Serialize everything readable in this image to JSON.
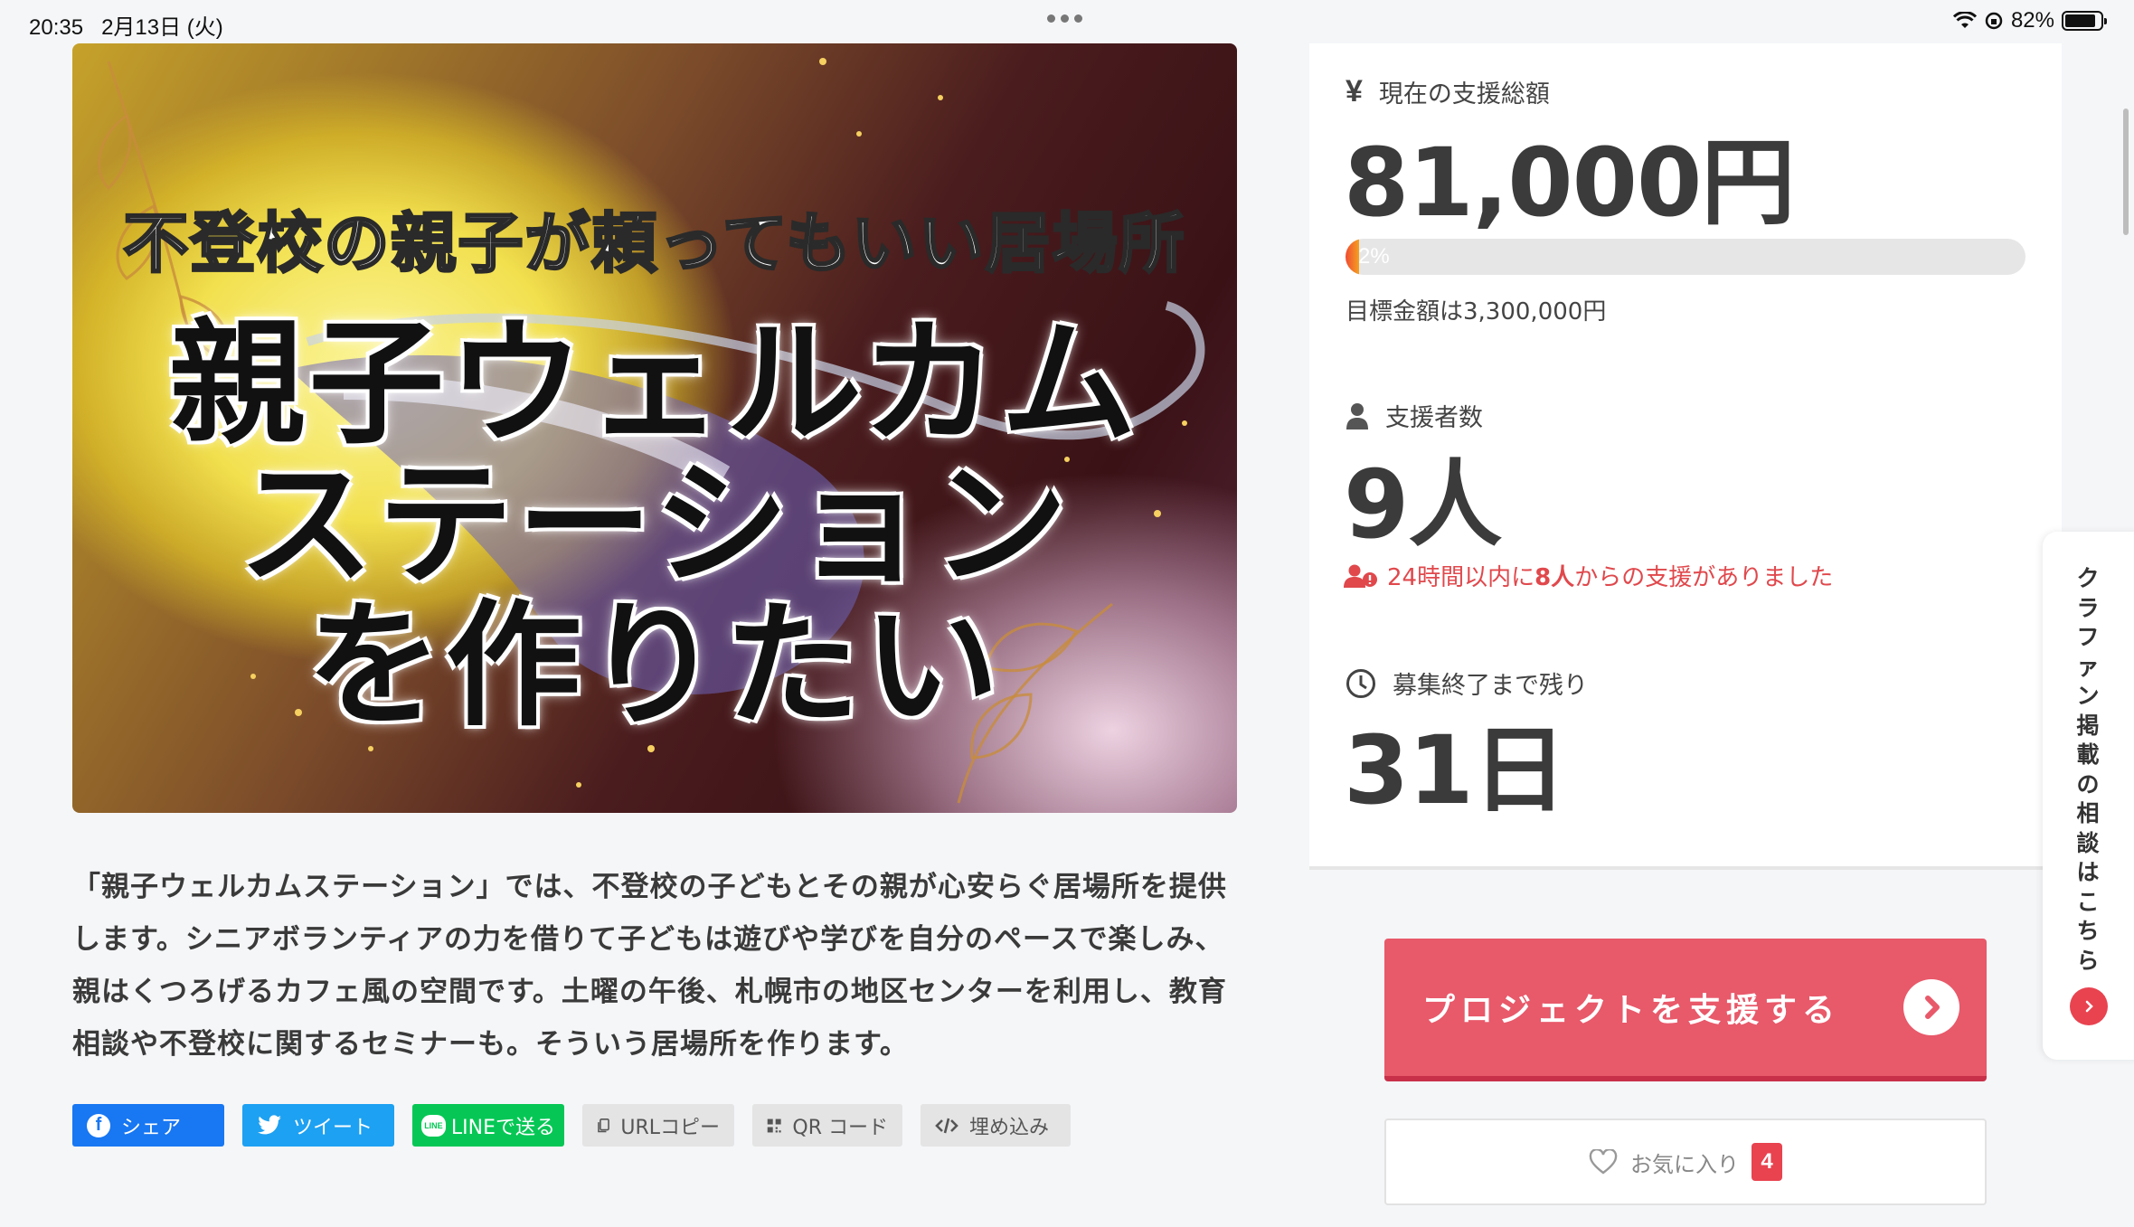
{
  "status_bar": {
    "time": "20:35",
    "date": "2月13日 (火)",
    "battery": "82%"
  },
  "hero": {
    "subtitle": "不登校の親子が頼ってもいい居場所",
    "title_lines": [
      "親子ウェルカム",
      "ステーション",
      "を作りたい"
    ]
  },
  "description": "「親子ウェルカムステーション」では、不登校の子どもとその親が心安らぐ居場所を提供します。シニアボランティアの力を借りて子どもは遊びや学びを自分のペースで楽しみ、親はくつろげるカフェ風の空間です。土曜の午後、札幌市の地区センターを利用し、教育相談や不登校に関するセミナーも。そういう居場所を作ります。",
  "share": {
    "facebook": "シェア",
    "twitter": "ツイート",
    "line": "LINEで送る",
    "url_copy": "URLコピー",
    "qr": "QR コード",
    "embed": "埋め込み"
  },
  "stats": {
    "total_label": "現在の支援総額",
    "total_value": "81,000円",
    "progress_text": "2%",
    "progress": 0.02,
    "goal_text": "目標金額は3,300,000円",
    "backers_label": "支援者数",
    "backers_value": "9人",
    "recent_prefix": "24時間以内に",
    "recent_count": "8人",
    "recent_suffix": "からの支援がありました",
    "remaining_label": "募集終了まで残り",
    "remaining_value": "31日"
  },
  "actions": {
    "support_label": "プロジェクトを支援する",
    "favorite_label": "お気に入り",
    "favorite_count": "4"
  },
  "side_tab": {
    "text": "クラファン掲載の相談はこちら"
  },
  "colors": {
    "accent": "#e8596a",
    "alert": "#e0484c",
    "facebook": "#1877f2",
    "twitter": "#1da1f2",
    "line": "#06c755"
  }
}
